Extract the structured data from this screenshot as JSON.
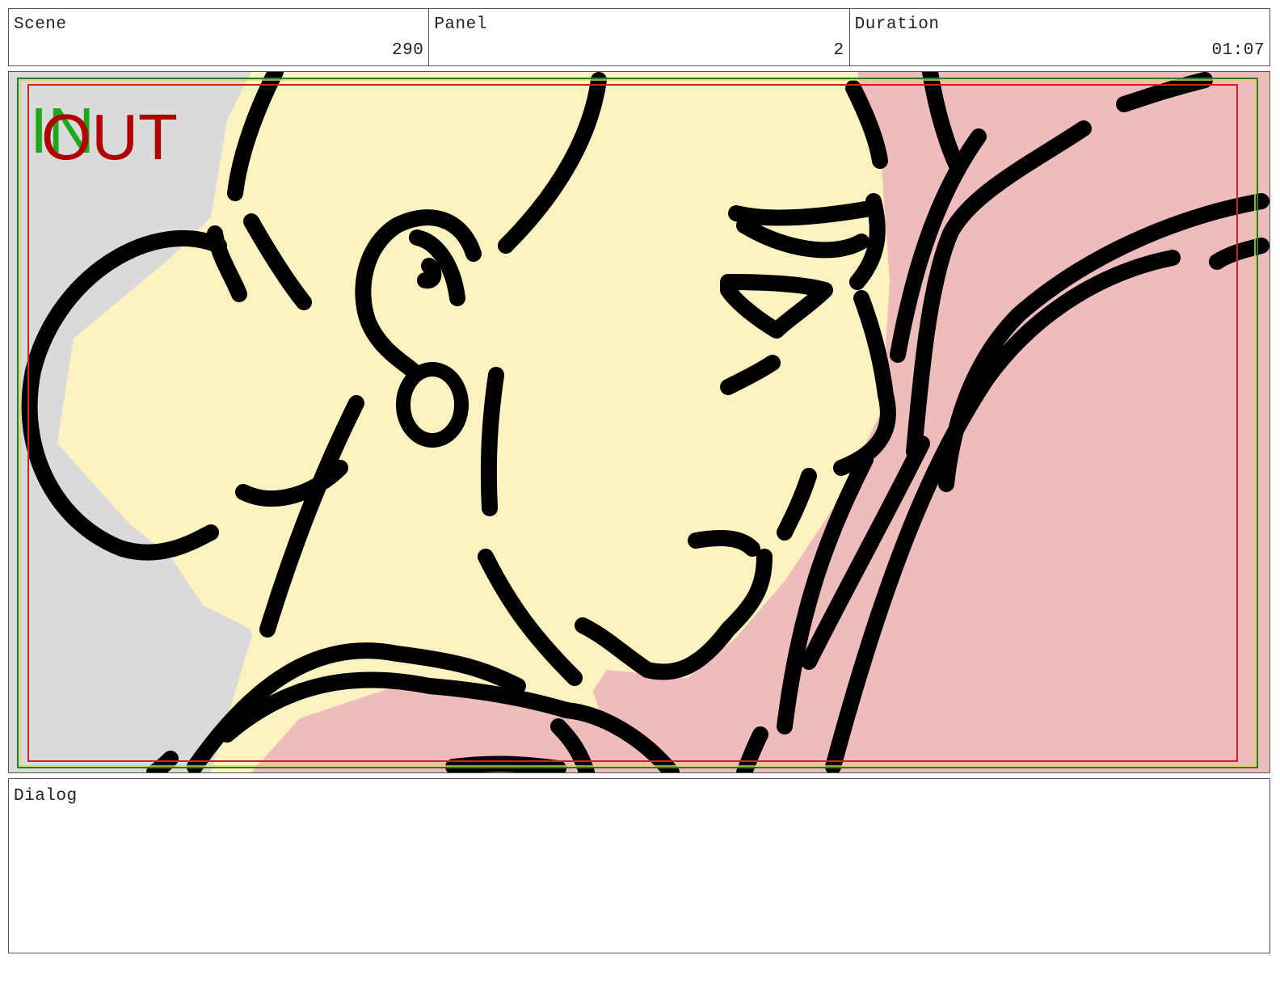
{
  "header": {
    "scene_label": "Scene",
    "scene_value": "290",
    "panel_label": "Panel",
    "panel_value": "2",
    "duration_label": "Duration",
    "duration_value": "01:07"
  },
  "frame": {
    "in_marker": "IN",
    "out_marker": "OUT",
    "colors": {
      "skin": "#fdf2c0",
      "background_pink": "#eebcbb",
      "background_gray": "#dadada",
      "ink": "#000000",
      "in_marker": "#1aaa1a",
      "out_marker": "#b00000",
      "safe_frame_red": "#cc2222",
      "safe_frame_green": "#2a7a2a"
    }
  },
  "dialog": {
    "label": "Dialog",
    "text": ""
  }
}
